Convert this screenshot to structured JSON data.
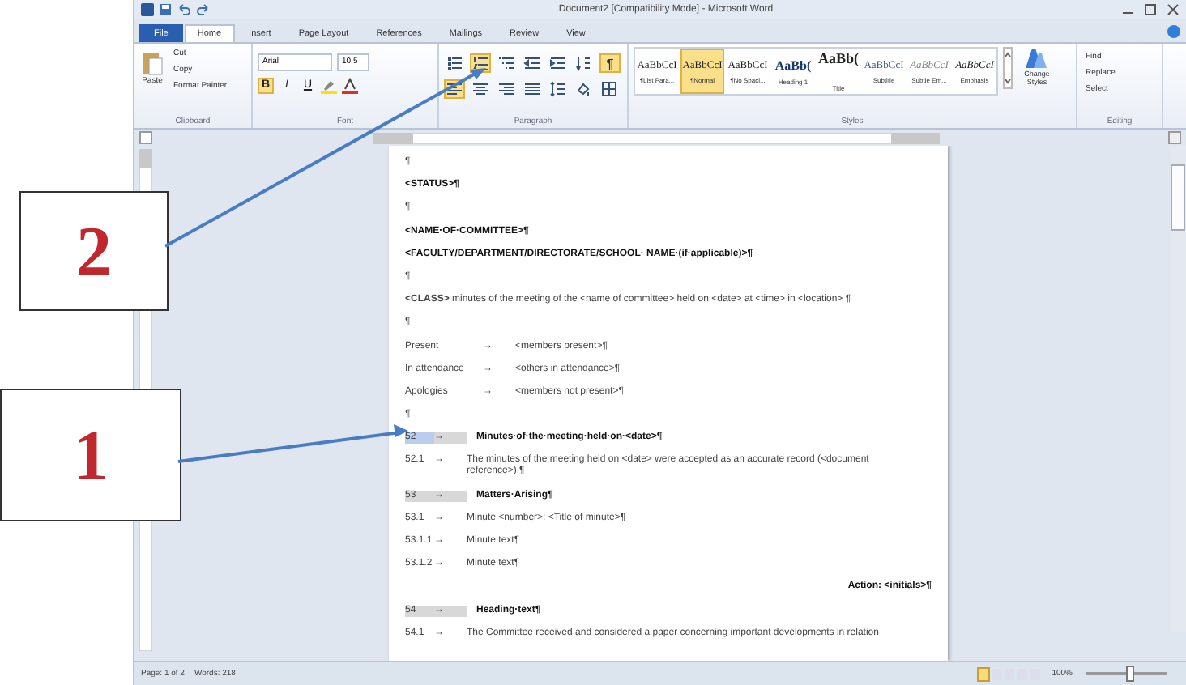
{
  "window": {
    "title": "Document2 [Compatibility Mode] - Microsoft Word"
  },
  "tabs": [
    {
      "label": "File",
      "kind": "file",
      "selected": false
    },
    {
      "label": "Home",
      "kind": "tab",
      "selected": true
    },
    {
      "label": "Insert",
      "kind": "tab",
      "selected": false
    },
    {
      "label": "Page Layout",
      "kind": "tab",
      "selected": false
    },
    {
      "label": "References",
      "kind": "tab",
      "selected": false
    },
    {
      "label": "Mailings",
      "kind": "tab",
      "selected": false
    },
    {
      "label": "Review",
      "kind": "tab",
      "selected": false
    },
    {
      "label": "View",
      "kind": "tab",
      "selected": false
    }
  ],
  "clipboard": {
    "paste": "Paste",
    "cut": "Cut",
    "copy": "Copy",
    "format_painter": "Format Painter",
    "label": "Clipboard"
  },
  "font": {
    "name": "Arial",
    "size": "10.5",
    "styles": [
      {
        "label": "B",
        "kind": "bold",
        "selected": true
      },
      {
        "label": "I",
        "kind": "italic",
        "selected": false
      },
      {
        "label": "U",
        "kind": "underline",
        "selected": false
      }
    ],
    "label": "Font"
  },
  "paragraph": {
    "row1": [
      {
        "kind": "bullets",
        "selected": false
      },
      {
        "kind": "numbering",
        "selected": true
      },
      {
        "kind": "multilevel",
        "selected": false
      },
      {
        "kind": "outdent",
        "selected": false
      },
      {
        "kind": "indent",
        "selected": false
      },
      {
        "kind": "sort",
        "selected": false
      },
      {
        "kind": "pilcrow",
        "label": "¶",
        "selected": true
      }
    ],
    "row2": [
      {
        "kind": "left",
        "selected": true
      },
      {
        "kind": "center",
        "selected": false
      },
      {
        "kind": "right",
        "selected": false
      },
      {
        "kind": "justify",
        "selected": false
      },
      {
        "kind": "spacing",
        "selected": false
      },
      {
        "kind": "shading",
        "selected": false
      },
      {
        "kind": "borders",
        "selected": false
      }
    ],
    "label": "Paragraph"
  },
  "styles": {
    "items": [
      {
        "preview": "AaBbCcI",
        "name": "¶List Para...",
        "kind": "normal",
        "selected": false
      },
      {
        "preview": "AaBbCcI",
        "name": "¶Normal",
        "kind": "normal",
        "selected": true
      },
      {
        "preview": "AaBbCcI",
        "name": "¶No Spaci...",
        "kind": "normal",
        "selected": false
      },
      {
        "preview": "AaBb(",
        "name": "Heading 1",
        "kind": "heading",
        "selected": false
      },
      {
        "preview": "AaBb(",
        "name": "Title",
        "kind": "title",
        "selected": false
      },
      {
        "preview": "AaBbCcI",
        "name": "Subtitle",
        "kind": "subtitle",
        "selected": false
      },
      {
        "preview": "AaBbCcI",
        "name": "Subtle Em...",
        "kind": "subtle",
        "selected": false
      },
      {
        "preview": "AaBbCcI",
        "name": "Emphasis",
        "kind": "emphasis",
        "selected": false
      }
    ],
    "change": "Change Styles",
    "label": "Styles"
  },
  "editing": {
    "items": [
      "Find",
      "Replace",
      "Select"
    ],
    "label": "Editing"
  },
  "document": [
    {
      "kind": "mark",
      "text": "¶"
    },
    {
      "kind": "bold",
      "text": "<STATUS>¶"
    },
    {
      "kind": "mark",
      "text": "¶"
    },
    {
      "kind": "bold",
      "text": "<NAME·OF·COMMITTEE>¶"
    },
    {
      "kind": "bold",
      "text": "<FACULTY/DEPARTMENT/DIRECTORATE/SCHOOL· NAME·(if·applicable)>¶"
    },
    {
      "kind": "mark",
      "text": "¶"
    },
    {
      "kind": "text",
      "text": "**<CLASS>** minutes of the meeting of the <name of committee> held on <date> at <time> in <location> ¶"
    },
    {
      "kind": "mark",
      "text": "¶"
    },
    {
      "kind": "tabbed",
      "label": "Present",
      "arrow": "→",
      "text": "<members present>¶"
    },
    {
      "kind": "tabbed",
      "label": "In attendance",
      "arrow": "→",
      "text": "<others in attendance>¶"
    },
    {
      "kind": "tabbed",
      "label": "Apologies",
      "arrow": "→",
      "text": "<members not present>¶"
    },
    {
      "kind": "mark",
      "text": "¶"
    },
    {
      "kind": "heading",
      "number": "52",
      "arrow": "→",
      "text": "Minutes·of·the·meeting·held·on·<date>¶",
      "selected": true
    },
    {
      "kind": "item",
      "number": "52.1",
      "arrow": "→",
      "text": "The minutes of the meeting held on <date> were accepted as an accurate record (<document reference>).¶"
    },
    {
      "kind": "heading",
      "number": "53",
      "arrow": "→",
      "text": "Matters·Arising¶",
      "selected": false
    },
    {
      "kind": "item",
      "number": "53.1",
      "arrow": "→",
      "text": "Minute <number>: <Title of minute>¶"
    },
    {
      "kind": "item",
      "number": "53.1.1",
      "arrow": "→",
      "text": "Minute text¶"
    },
    {
      "kind": "item",
      "number": "53.1.2",
      "arrow": "→",
      "text": "Minute text¶"
    },
    {
      "kind": "action",
      "text": "Action: <initials>¶"
    },
    {
      "kind": "heading",
      "number": "54",
      "arrow": "→",
      "text": "Heading·text¶",
      "selected": false
    },
    {
      "kind": "item",
      "number": "54.1",
      "arrow": "→",
      "text": "The Committee received and considered a paper concerning important developments in relation"
    }
  ],
  "status_bar": {
    "page": "Page: 1 of 2",
    "words": "Words: 218",
    "zoom": "100%",
    "zoom_slider": {
      "level": 0.5
    }
  },
  "callouts": [
    {
      "label": "2"
    },
    {
      "label": "1"
    }
  ]
}
